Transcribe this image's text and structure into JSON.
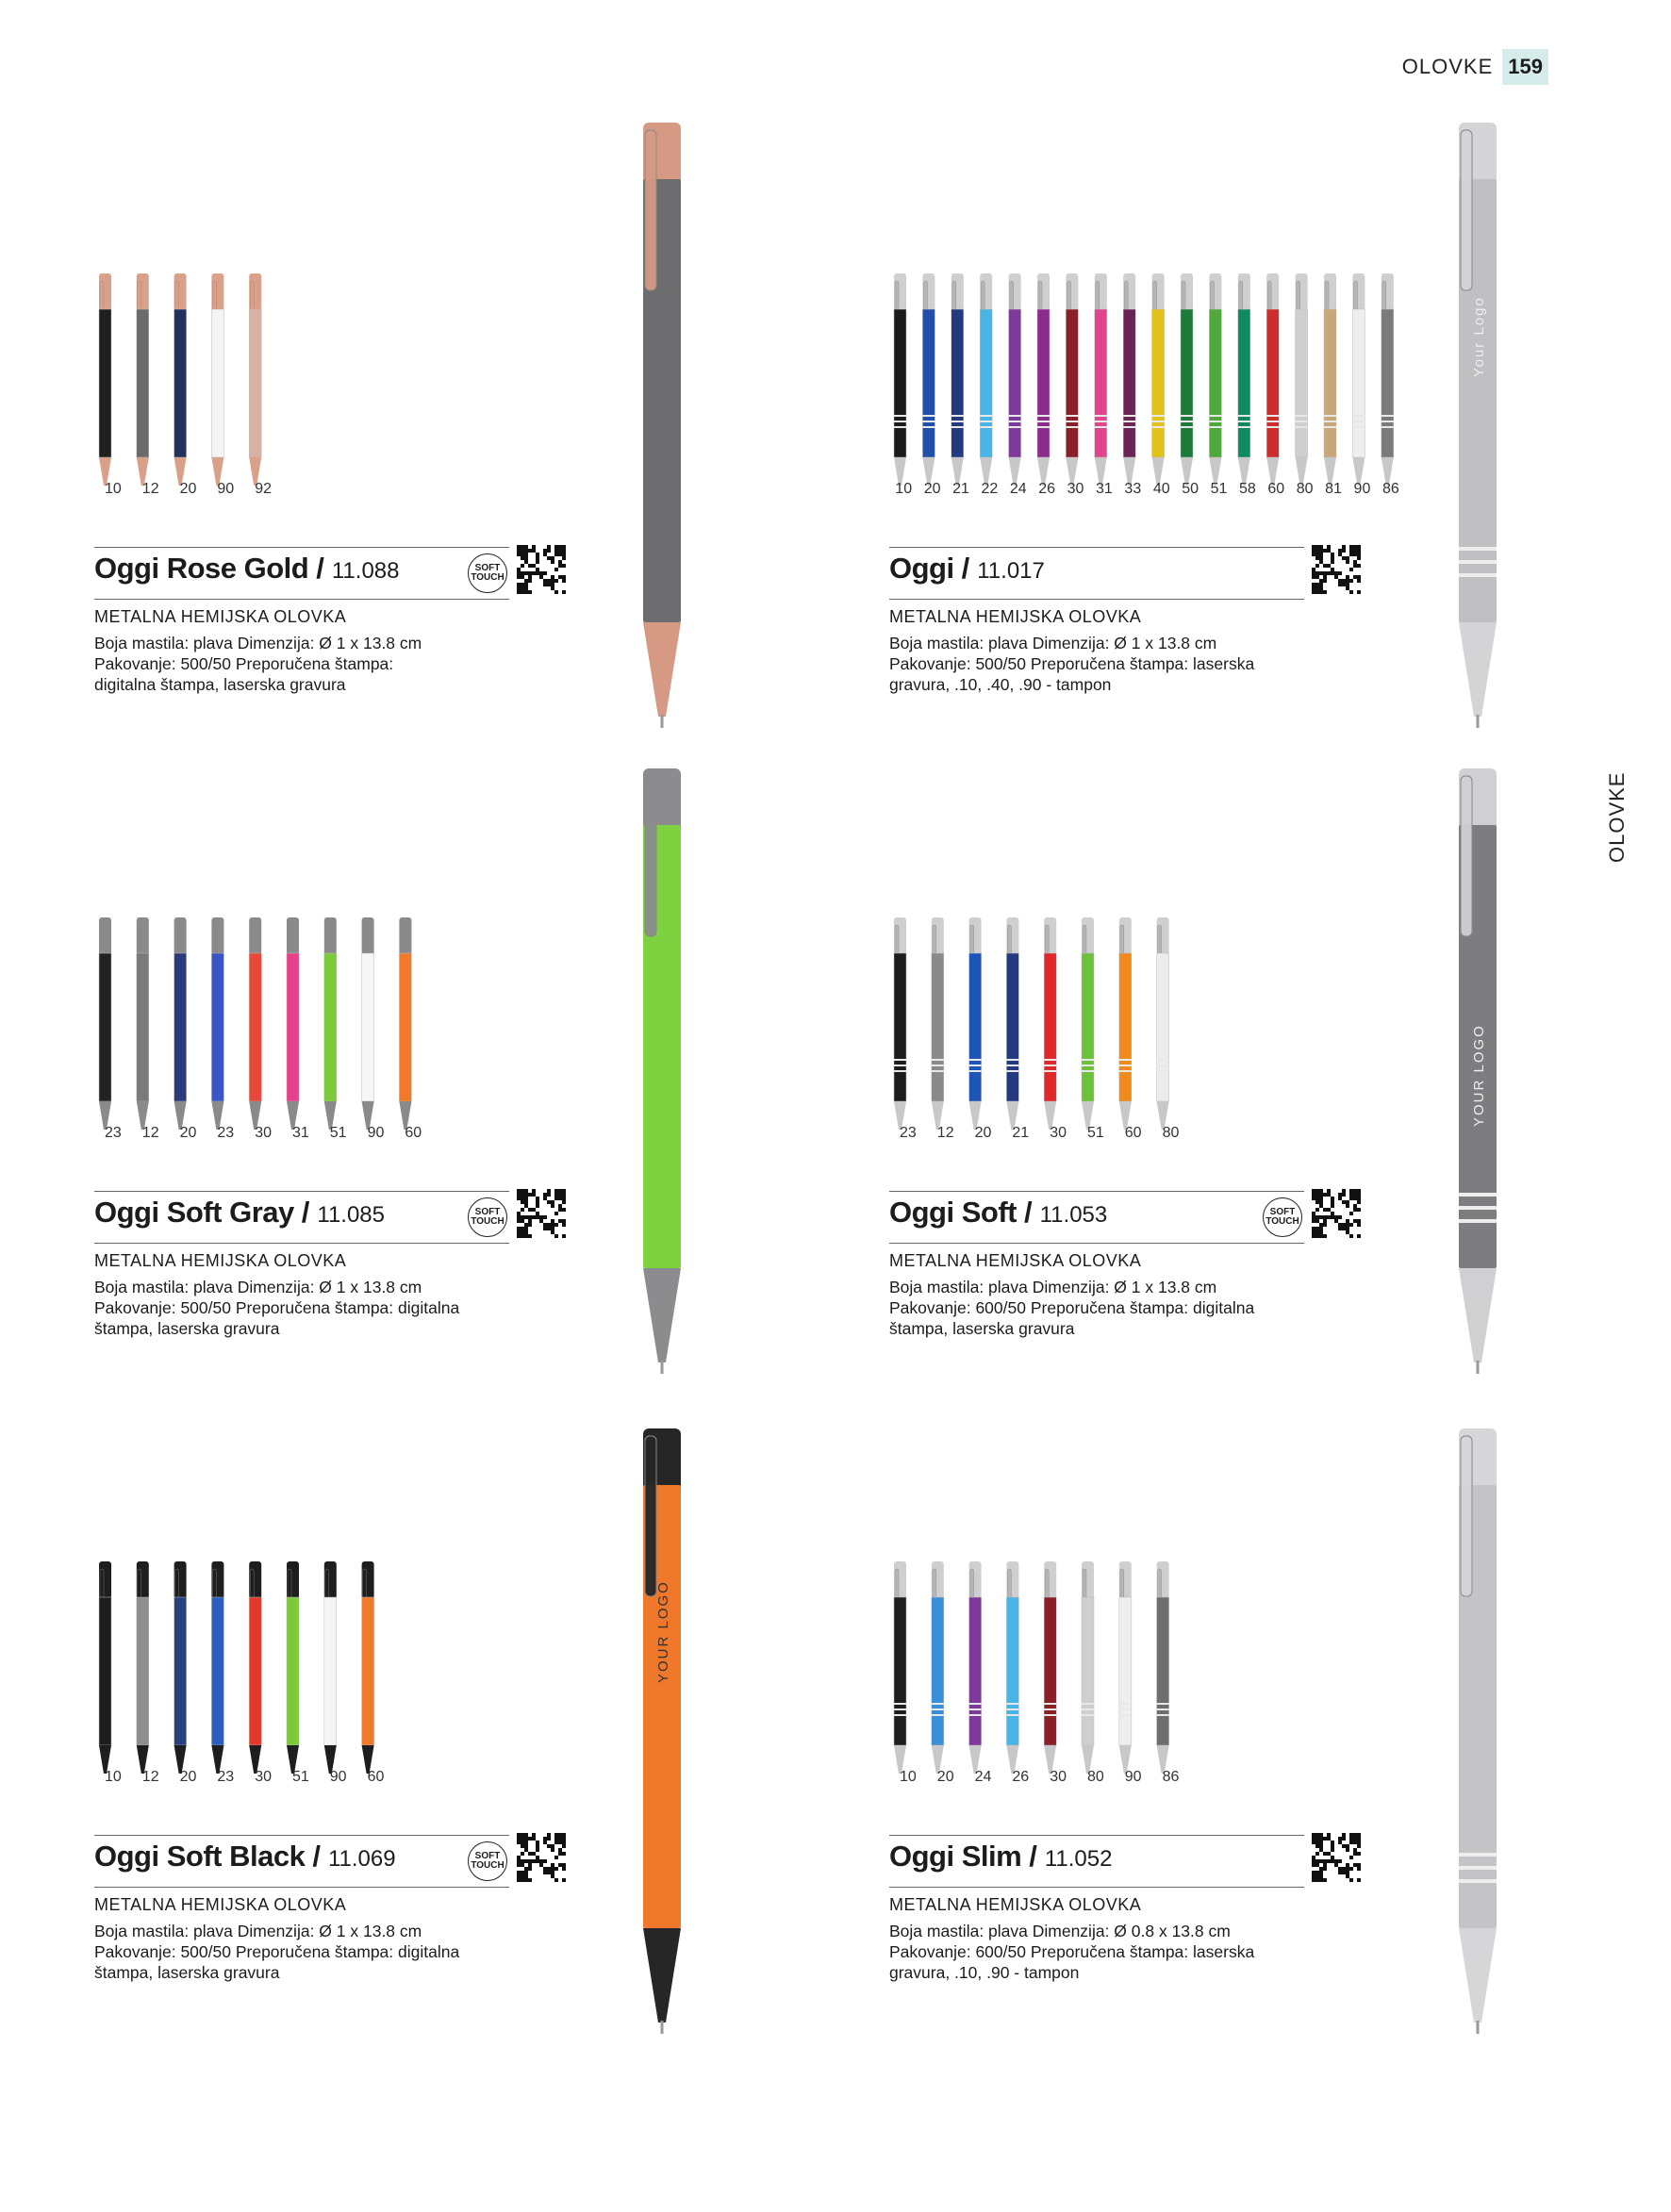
{
  "header": {
    "section": "OLOVKE",
    "page_number": "159"
  },
  "side_label": "OLOVKE",
  "products": [
    {
      "id": "rose-gold",
      "name": "Oggi Rose Gold",
      "code": "11.088",
      "soft_touch": true,
      "type": "METALNA HEMIJSKA OLOVKA",
      "desc": [
        "Boja mastila: plava Dimenzija: Ø 1 x 13.8 cm",
        "Pakovanje: 500/50 Preporučena štampa:",
        "digitalna štampa, laserska gravura"
      ],
      "style": "soft",
      "trim": "#d9a08a",
      "colors": [
        "#1f1f1f",
        "#6b6b6b",
        "#24305e",
        "#f4f4f4",
        "#d7b2a4"
      ],
      "codes": [
        "10",
        "12",
        "20",
        "90",
        "92"
      ],
      "hero": {
        "body": "#6d6d6f",
        "trim": "#d69a84",
        "logo": ""
      }
    },
    {
      "id": "oggi",
      "name": "Oggi",
      "code": "11.017",
      "soft_touch": false,
      "type": "METALNA HEMIJSKA OLOVKA",
      "desc": [
        "Boja mastila: plava Dimenzija: Ø 1 x 13.8 cm",
        "Pakovanje: 500/50 Preporučena štampa: laserska",
        "gravura, .10, .40, .90 - tampon"
      ],
      "style": "metal",
      "trim": "#c9c9c9",
      "colors": [
        "#1b1b1b",
        "#1f4fa8",
        "#233a80",
        "#49b5e4",
        "#7e3a9a",
        "#8b2c8c",
        "#8a1f2a",
        "#e0458e",
        "#6b2454",
        "#e3c21a",
        "#1c7a3a",
        "#4fa83a",
        "#0f8a5e",
        "#cf2c2c",
        "#cfcfcf",
        "#c8a878",
        "#eeeeee",
        "#7a7a7a"
      ],
      "codes": [
        "10",
        "20",
        "21",
        "22",
        "24",
        "26",
        "30",
        "31",
        "33",
        "40",
        "50",
        "51",
        "58",
        "60",
        "80",
        "81",
        "90",
        "86"
      ],
      "hero": {
        "body": "#c0c0c2",
        "trim": "#d4d4d6",
        "logo": "Your Logo"
      }
    },
    {
      "id": "soft-gray",
      "name": "Oggi Soft Gray",
      "code": "11.085",
      "soft_touch": true,
      "type": "METALNA HEMIJSKA OLOVKA",
      "desc": [
        "Boja mastila: plava Dimenzija: Ø 1 x 13.8 cm",
        "Pakovanje: 500/50 Preporučena štampa: digitalna",
        "štampa, laserska gravura"
      ],
      "style": "soft",
      "trim": "#8a8a8c",
      "colors": [
        "#222222",
        "#7a7a7a",
        "#2b3a7a",
        "#3a55c8",
        "#e8483a",
        "#e83f8a",
        "#7cc93a",
        "#f6f6f6",
        "#f07a2a"
      ],
      "codes": [
        "23",
        "12",
        "20",
        "23",
        "30",
        "31",
        "51",
        "90",
        "60"
      ],
      "hero": {
        "body": "#7fd23f",
        "trim": "#8c8c8e",
        "logo": ""
      }
    },
    {
      "id": "soft",
      "name": "Oggi Soft",
      "code": "11.053",
      "soft_touch": true,
      "type": "METALNA HEMIJSKA OLOVKA",
      "desc": [
        "Boja mastila: plava Dimenzija: Ø 1 x 13.8 cm",
        "Pakovanje: 600/50 Preporučena štampa: digitalna",
        "štampa, laserska gravura"
      ],
      "style": "metal",
      "trim": "#cfcfcf",
      "colors": [
        "#1c1c1c",
        "#8a8a8a",
        "#1f55b8",
        "#233a80",
        "#e0282a",
        "#6cc23a",
        "#f08a1a",
        "#ececec"
      ],
      "codes": [
        "23",
        "12",
        "20",
        "21",
        "30",
        "51",
        "60",
        "80"
      ],
      "hero": {
        "body": "#7d7d7f",
        "trim": "#d0d0d2",
        "logo": "YOUR LOGO"
      }
    },
    {
      "id": "soft-black",
      "name": "Oggi Soft Black",
      "code": "11.069",
      "soft_touch": true,
      "type": "METALNA HEMIJSKA OLOVKA",
      "desc": [
        "Boja mastila: plava Dimenzija: Ø 1 x 13.8 cm",
        "Pakovanje: 500/50 Preporučena štampa: digitalna",
        "štampa, laserska gravura"
      ],
      "style": "soft",
      "trim": "#1e1e1e",
      "colors": [
        "#1e1e1e",
        "#8e8e8e",
        "#27407e",
        "#2a5ec0",
        "#e23a2a",
        "#7cc93a",
        "#f4f4f4",
        "#f07a2a"
      ],
      "codes": [
        "10",
        "12",
        "20",
        "23",
        "30",
        "51",
        "90",
        "60"
      ],
      "hero": {
        "body": "#f0782a",
        "trim": "#262626",
        "logo": "YOUR LOGO"
      }
    },
    {
      "id": "slim",
      "name": "Oggi Slim",
      "code": "11.052",
      "soft_touch": false,
      "type": "METALNA HEMIJSKA OLOVKA",
      "desc": [
        "Boja mastila: plava Dimenzija: Ø 0.8 x 13.8 cm",
        "Pakovanje: 600/50 Preporučena štampa: laserska",
        "gravura, .10, .90 - tampon"
      ],
      "style": "metal",
      "trim": "#cfcfcf",
      "colors": [
        "#1e1e1e",
        "#3a8fd8",
        "#7e3a9a",
        "#49b5e4",
        "#8a1f2a",
        "#cfcfcf",
        "#eeeeee",
        "#6e6e6e"
      ],
      "codes": [
        "10",
        "20",
        "24",
        "26",
        "30",
        "80",
        "90",
        "86"
      ],
      "hero": {
        "body": "#c4c4c6",
        "trim": "#d6d6d8",
        "logo": ""
      }
    }
  ]
}
